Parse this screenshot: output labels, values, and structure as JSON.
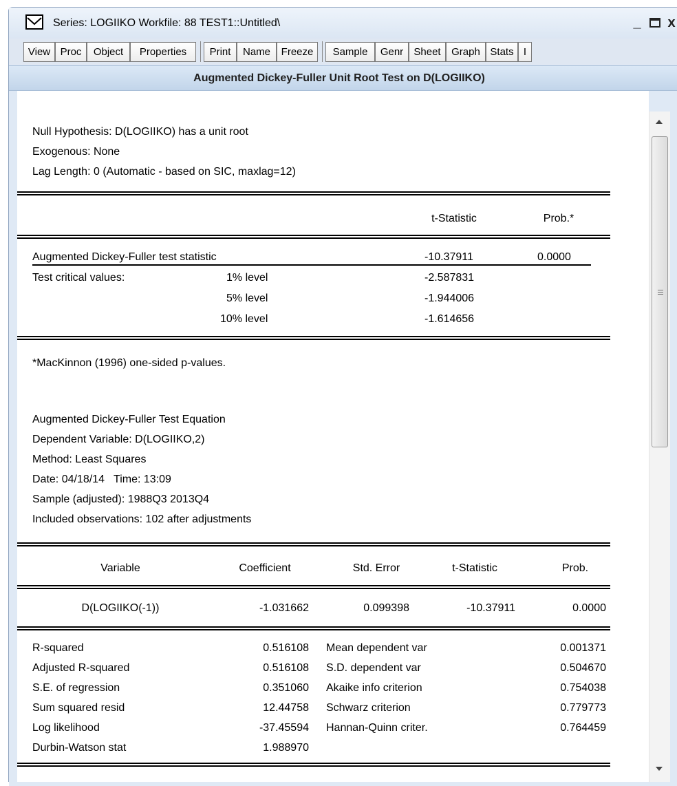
{
  "window": {
    "title": "Series: LOGIIKO   Workfile: 88 TEST1::Untitled\\",
    "icon": "series-icon",
    "controls": {
      "minimize": "_",
      "maximize": "□",
      "close": "x"
    }
  },
  "toolbar": {
    "view": "View",
    "proc": "Proc",
    "object": "Object",
    "properties": "Properties",
    "print": "Print",
    "name": "Name",
    "freeze": "Freeze",
    "sample": "Sample",
    "genr": "Genr",
    "sheet": "Sheet",
    "graph": "Graph",
    "stats": "Stats",
    "ident": "I"
  },
  "header": {
    "title": "Augmented Dickey-Fuller Unit Root Test on D(LOGIIKO)"
  },
  "test": {
    "null_hypothesis": "Null Hypothesis: D(LOGIIKO) has a unit root",
    "exogenous": "Exogenous: None",
    "lag_length": "Lag Length: 0 (Automatic - based on SIC, maxlag=12)",
    "col_tstat": "t-Statistic",
    "col_prob": "Prob.*",
    "adf_label": "Augmented Dickey-Fuller test statistic",
    "adf_tstat": "-10.37911",
    "adf_prob": "0.0000",
    "critical_label": "Test critical values:",
    "level1": "1% level",
    "level1_val": "-2.587831",
    "level5": "5% level",
    "level5_val": "-1.944006",
    "level10": "10% level",
    "level10_val": "-1.614656",
    "footnote": "*MacKinnon (1996) one-sided p-values."
  },
  "equation": {
    "title": "Augmented Dickey-Fuller Test Equation",
    "dependent": "Dependent Variable: D(LOGIIKO,2)",
    "method": "Method: Least Squares",
    "datetime": "Date: 04/18/14   Time: 13:09",
    "sample": "Sample (adjusted): 1988Q3 2013Q4",
    "observations": "Included observations: 102 after adjustments"
  },
  "coef_table": {
    "headers": {
      "variable": "Variable",
      "coefficient": "Coefficient",
      "std_error": "Std. Error",
      "tstat": "t-Statistic",
      "prob": "Prob."
    },
    "row": {
      "variable": "D(LOGIIKO(-1))",
      "coefficient": "-1.031662",
      "std_error": "0.099398",
      "tstat": "-10.37911",
      "prob": "0.0000"
    }
  },
  "stats": {
    "left": [
      {
        "label": "R-squared",
        "value": "0.516108"
      },
      {
        "label": "Adjusted R-squared",
        "value": "0.516108"
      },
      {
        "label": "S.E. of regression",
        "value": "0.351060"
      },
      {
        "label": "Sum squared resid",
        "value": "12.44758"
      },
      {
        "label": "Log likelihood",
        "value": "-37.45594"
      },
      {
        "label": "Durbin-Watson stat",
        "value": "1.988970"
      }
    ],
    "right": [
      {
        "label": "Mean dependent var",
        "value": "0.001371"
      },
      {
        "label": "S.D. dependent var",
        "value": "0.504670"
      },
      {
        "label": "Akaike info criterion",
        "value": "0.754038"
      },
      {
        "label": "Schwarz criterion",
        "value": "0.779773"
      },
      {
        "label": "Hannan-Quinn criter.",
        "value": "0.764459"
      }
    ]
  }
}
